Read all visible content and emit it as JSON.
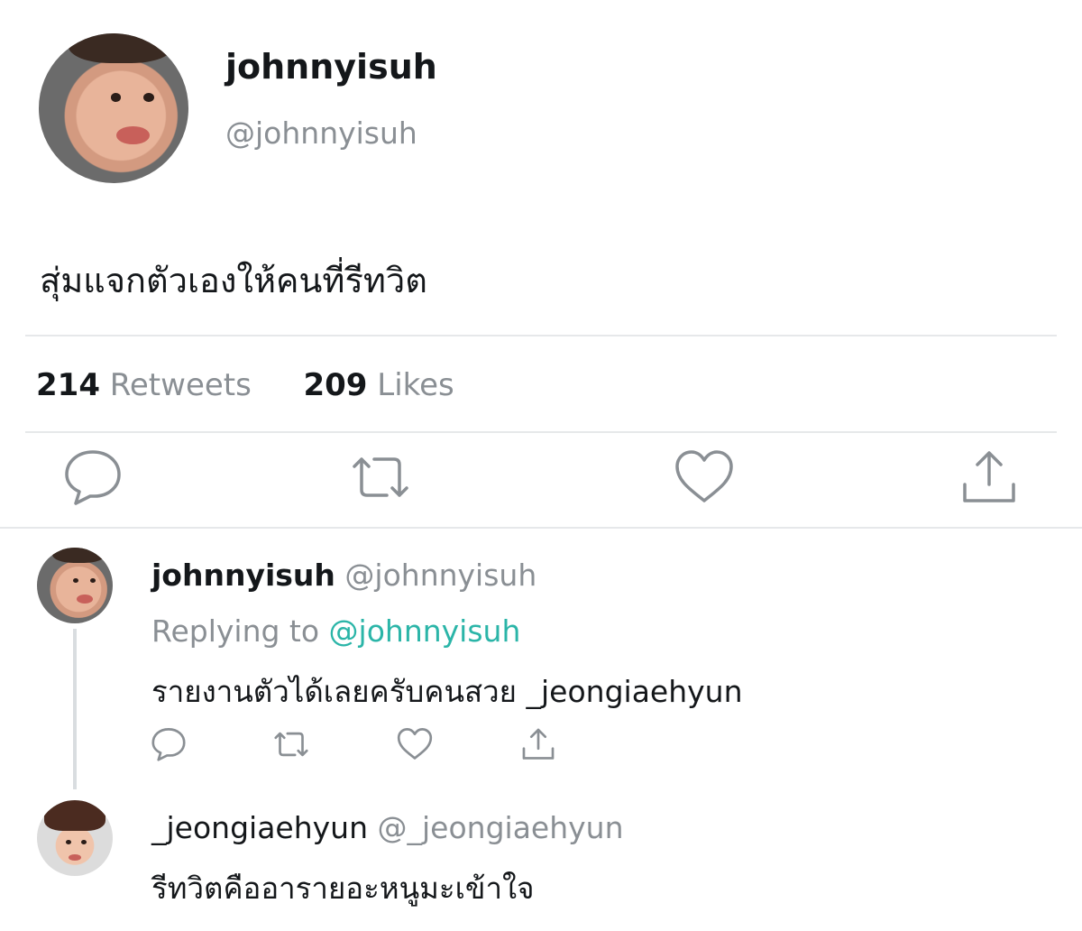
{
  "tweet": {
    "display_name": "johnnyisuh",
    "handle": "@johnnyisuh",
    "text": "สุ่มแจกตัวเองให้คนที่รีทวิต",
    "retweets_count": "214",
    "retweets_label": "Retweets",
    "likes_count": "209",
    "likes_label": "Likes"
  },
  "reply1": {
    "display_name": "johnnyisuh",
    "handle": "@johnnyisuh",
    "replying_prefix": "Replying to",
    "replying_to": "@johnnyisuh",
    "text": "รายงานตัวได้เลยครับคนสวย _jeongiaehyun"
  },
  "reply2": {
    "display_name": "_jeongiaehyun",
    "handle": "@_jeongiaehyun",
    "text": "รีทวิตคืออารายอะหนูมะเข้าใจ"
  },
  "icons": {
    "reply": "reply-icon",
    "retweet": "retweet-icon",
    "like": "heart-icon",
    "share": "share-icon"
  },
  "colors": {
    "accent": "#2bb5a8",
    "icon": "#8a8f94",
    "divider": "#e6e8ea"
  }
}
